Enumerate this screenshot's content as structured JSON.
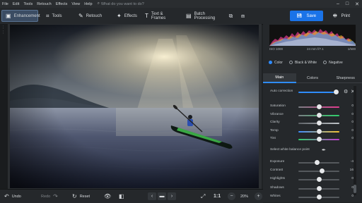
{
  "menu": {
    "items": [
      "File",
      "Edit",
      "Tools",
      "Retouch",
      "Effects",
      "View",
      "Help"
    ],
    "search_placeholder": "What do you want to do?",
    "window_controls": [
      "–",
      "□",
      "✕"
    ]
  },
  "toolbar": {
    "tabs": [
      {
        "label": "Enhancement",
        "icon": "enhancement-icon"
      },
      {
        "label": "Tools",
        "icon": "crop-icon"
      },
      {
        "label": "Retouch",
        "icon": "brush-icon"
      },
      {
        "label": "Effects",
        "icon": "wand-icon"
      },
      {
        "label": "Text & Frames",
        "icon": "text-icon"
      },
      {
        "label": "Batch Processing",
        "icon": "batch-icon"
      }
    ],
    "save_label": "Save",
    "print_label": "Print"
  },
  "histogram": {
    "iso": "ISO 1000",
    "lens": "24 mm f/7.1",
    "shutter": "1/500"
  },
  "modes": {
    "color": "Color",
    "bw": "Black & White",
    "negative": "Negative",
    "selected": "Color"
  },
  "panel_tabs": [
    "Main",
    "Colors",
    "Sharpness"
  ],
  "panel_active_tab": "Main",
  "auto_correction": "Auto correction",
  "white_balance_label": "Select white balance point",
  "sliders_color": [
    {
      "label": "Saturation",
      "value": "0",
      "level": 0.5
    },
    {
      "label": "Vibrance",
      "value": "0",
      "level": 0.5
    },
    {
      "label": "Clarity",
      "value": "0",
      "level": 0.5
    },
    {
      "label": "Temp",
      "value": "0",
      "level": 0.5
    },
    {
      "label": "Tint",
      "value": "0",
      "level": 0.5
    }
  ],
  "sliders_tone": [
    {
      "label": "Exposure",
      "value": "-4",
      "level": 0.45
    },
    {
      "label": "Contrast",
      "value": "16",
      "level": 0.58
    },
    {
      "label": "Highlights",
      "value": "0",
      "level": 0.5
    },
    {
      "label": "Shadows",
      "value": "0",
      "level": 0.5
    },
    {
      "label": "Whites",
      "value": "0",
      "level": 0.5
    }
  ],
  "bottom": {
    "undo": "Undo",
    "redo": "Redo",
    "reset": "Reset",
    "one_to_one": "1:1",
    "zoom": "20%"
  },
  "colors": {
    "accent": "#1a73e8",
    "tab_active": "#3b4c63"
  }
}
